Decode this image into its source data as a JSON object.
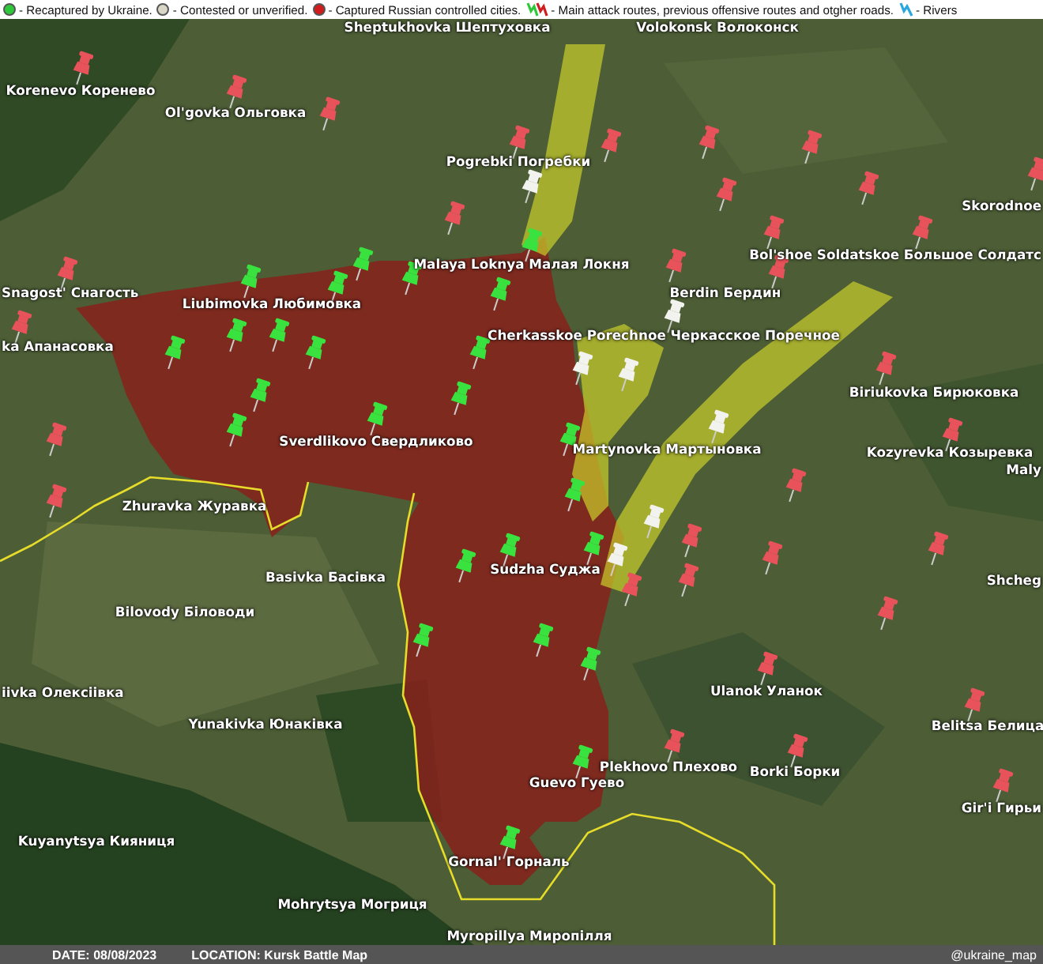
{
  "legend": [
    {
      "kind": "dot",
      "color": "#2ec93a",
      "label": "- Recaptured by Ukraine."
    },
    {
      "kind": "dot",
      "color": "#d9d6c8",
      "label": "- Contested or unverified."
    },
    {
      "kind": "dot",
      "color": "#d01c1c",
      "label": "- Captured Russian controlled cities."
    },
    {
      "kind": "route",
      "label": "- Main attack routes, previous offensive routes and otgher roads."
    },
    {
      "kind": "river",
      "label": "- Rivers"
    }
  ],
  "places": [
    {
      "name": "Sheptukhovka Шептуховка"
    },
    {
      "name": "Volokonsk Волоконск"
    },
    {
      "name": "Korenevo Коренево"
    },
    {
      "name": "Ol'govka Ольговка"
    },
    {
      "name": "Pogrebki Погребки"
    },
    {
      "name": "Skorodnoe"
    },
    {
      "name": "Bol'shoe Soldatskoe Большое Солдатс"
    },
    {
      "name": "Malaya Loknya Малая Локня"
    },
    {
      "name": "Snagost' Снагость"
    },
    {
      "name": "Liubimovka Любимовка"
    },
    {
      "name": "Berdin Бердин"
    },
    {
      "name": "Cherkasskoe Porechnoe Черкасское Поречное"
    },
    {
      "name": "ka Апанасовка"
    },
    {
      "name": "Biriukovka Бирюковка"
    },
    {
      "name": "Sverdlikovo Свердликово"
    },
    {
      "name": "Martynovka Мартыновка"
    },
    {
      "name": "Kozyrevka Козыревка"
    },
    {
      "name": "Maly"
    },
    {
      "name": "Zhuravka Журавка"
    },
    {
      "name": "Sudzha Суджа"
    },
    {
      "name": "Basivka Басівка"
    },
    {
      "name": "Shcheg"
    },
    {
      "name": "Bilovody Біловоди"
    },
    {
      "name": "iivka Олексіівка"
    },
    {
      "name": "Ulanok Уланок"
    },
    {
      "name": "Yunakivka Юнаківка"
    },
    {
      "name": "Belitsa Белица"
    },
    {
      "name": "Plekhovo Плехово"
    },
    {
      "name": "Borki Борки"
    },
    {
      "name": "Guevo Гуево"
    },
    {
      "name": "Gir'i Гирьи"
    },
    {
      "name": "Kuyanytsya Кияниця"
    },
    {
      "name": "Gornal' Горналь"
    },
    {
      "name": "Mohrytsya Могриця"
    },
    {
      "name": "Myropillya Миропілля"
    }
  ],
  "pins": [
    {
      "color": "#e8525a"
    },
    {
      "color": "#e8525a"
    },
    {
      "color": "#e8525a"
    },
    {
      "color": "#e8525a"
    },
    {
      "color": "#e8525a"
    },
    {
      "color": "#e8525a"
    },
    {
      "color": "#e8525a"
    },
    {
      "color": "#e8525a"
    },
    {
      "color": "#e8525a"
    },
    {
      "color": "#e8525a"
    },
    {
      "color": "#e8525a"
    },
    {
      "color": "#e8525a"
    },
    {
      "color": "#e8525a"
    },
    {
      "color": "#e8525a"
    },
    {
      "color": "#e8525a"
    },
    {
      "color": "#e8525a"
    },
    {
      "color": "#e8525a"
    },
    {
      "color": "#e8525a"
    },
    {
      "color": "#e8525a"
    },
    {
      "color": "#e8525a"
    },
    {
      "color": "#e8525a"
    },
    {
      "color": "#e8525a"
    },
    {
      "color": "#e8525a"
    },
    {
      "color": "#e8525a"
    },
    {
      "color": "#e8525a"
    },
    {
      "color": "#e8525a"
    },
    {
      "color": "#e8525a"
    },
    {
      "color": "#e8525a"
    },
    {
      "color": "#e8525a"
    },
    {
      "color": "#e8525a"
    },
    {
      "color": "#e8525a"
    },
    {
      "color": "#e8525a"
    },
    {
      "color": "#e8525a"
    },
    {
      "color": "#f2f2ee"
    },
    {
      "color": "#f2f2ee"
    },
    {
      "color": "#f2f2ee"
    },
    {
      "color": "#f2f2ee"
    },
    {
      "color": "#f2f2ee"
    },
    {
      "color": "#f2f2ee"
    },
    {
      "color": "#f2f2ee"
    },
    {
      "color": "#39e23f"
    },
    {
      "color": "#39e23f"
    },
    {
      "color": "#39e23f"
    },
    {
      "color": "#39e23f"
    },
    {
      "color": "#39e23f"
    },
    {
      "color": "#39e23f"
    },
    {
      "color": "#39e23f"
    },
    {
      "color": "#39e23f"
    },
    {
      "color": "#39e23f"
    },
    {
      "color": "#39e23f"
    },
    {
      "color": "#39e23f"
    },
    {
      "color": "#39e23f"
    },
    {
      "color": "#39e23f"
    },
    {
      "color": "#39e23f"
    },
    {
      "color": "#39e23f"
    },
    {
      "color": "#39e23f"
    },
    {
      "color": "#39e23f"
    },
    {
      "color": "#39e23f"
    },
    {
      "color": "#39e23f"
    },
    {
      "color": "#39e23f"
    },
    {
      "color": "#39e23f"
    },
    {
      "color": "#39e23f"
    },
    {
      "color": "#39e23f"
    },
    {
      "color": "#39e23f"
    },
    {
      "color": "#39e23f"
    }
  ],
  "footer": {
    "date": "DATE: 08/08/2023",
    "location": "LOCATION: Kursk Battle Map",
    "credit": "@ukraine_map"
  }
}
